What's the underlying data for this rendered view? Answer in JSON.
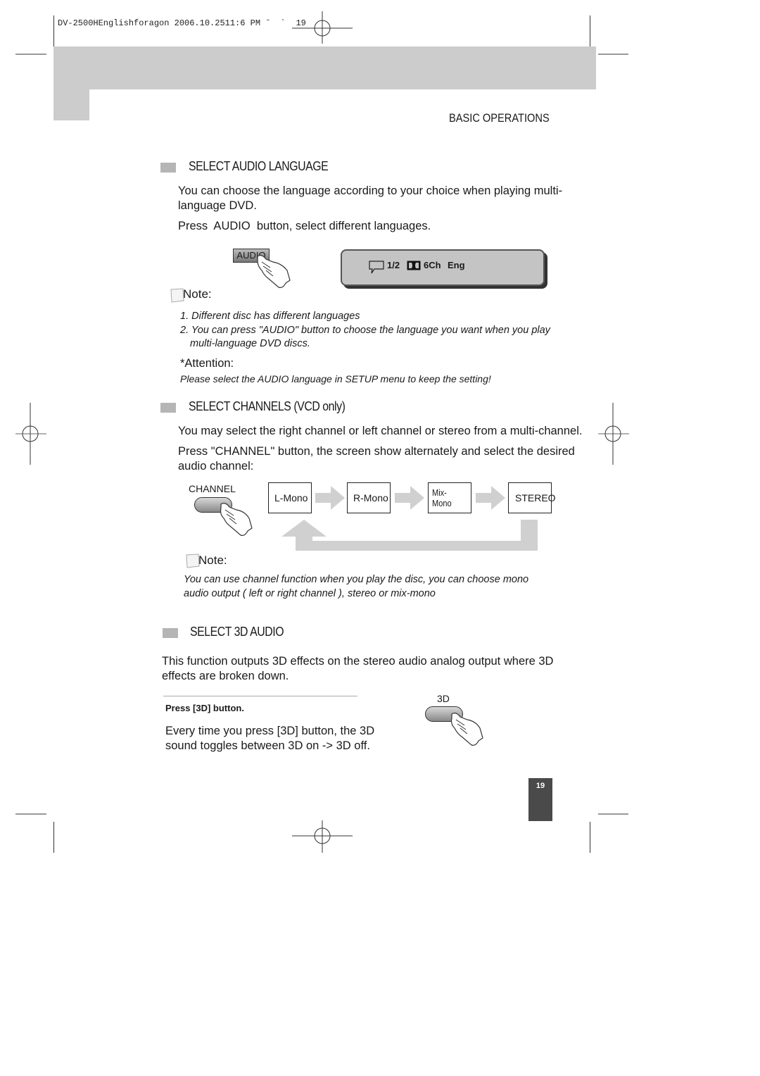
{
  "print_header": {
    "slug": "DV-2500HEnglishforagon 2006.10.2511:6 PM ˘  ˋ  19"
  },
  "running_head": "BASIC OPERATIONS",
  "sections": {
    "audio_language": {
      "title": "SELECT AUDIO LANGUAGE",
      "paragraph1_line1": "You can choose the language according to your choice when playing multi-",
      "paragraph1_line2": "language DVD.",
      "paragraph2": "Press  AUDIO  button, select different languages.",
      "button_label": "AUDIO",
      "osd": {
        "icon": "speech-bubble-icon",
        "track": "1/2",
        "format_icon": "dolby-digital-icon",
        "channels": "6Ch",
        "language": "Eng"
      },
      "note_label": "Note:",
      "notes": [
        "1. Different disc has different languages",
        "2. You can press \"AUDIO\" button to choose the language you want when you play",
        "multi-language DVD discs."
      ],
      "attention_label": "*Attention:",
      "attention_text": "Please select the AUDIO language in SETUP menu to keep the setting!"
    },
    "channels": {
      "title": "SELECT CHANNELS (VCD only)",
      "paragraph1": "You may select the right channel or left channel or stereo from a multi-channel.",
      "paragraph2_line1": "Press \"CHANNEL\" button, the screen show alternately and select the desired",
      "paragraph2_line2": "audio channel:",
      "button_label": "CHANNEL",
      "modes": [
        "L-Mono",
        "R-Mono",
        "Mix-Mono",
        "STEREO"
      ],
      "note_label": "Note:",
      "note_line1": "You can use channel function when you play the disc, you can choose mono",
      "note_line2": "audio output ( left or right channel ), stereo or mix-mono"
    },
    "audio_3d": {
      "title": "SELECT 3D AUDIO",
      "paragraph_line1": "This function outputs 3D effects on the stereo audio analog output where 3D",
      "paragraph_line2": "effects are broken down.",
      "press_label": "Press [3D] button.",
      "desc_line1": "Every time you press [3D] button, the 3D",
      "desc_line2": "sound toggles between 3D on -> 3D off.",
      "button_label": "3D"
    }
  },
  "page_number": "19",
  "colors": {
    "header_band": "#cccccc",
    "bullet_square": "#b5b5b5",
    "osd_fill": "#c4c4c4",
    "arrow_fill": "#d0d0d0",
    "page_tab": "#4a4a4a"
  }
}
